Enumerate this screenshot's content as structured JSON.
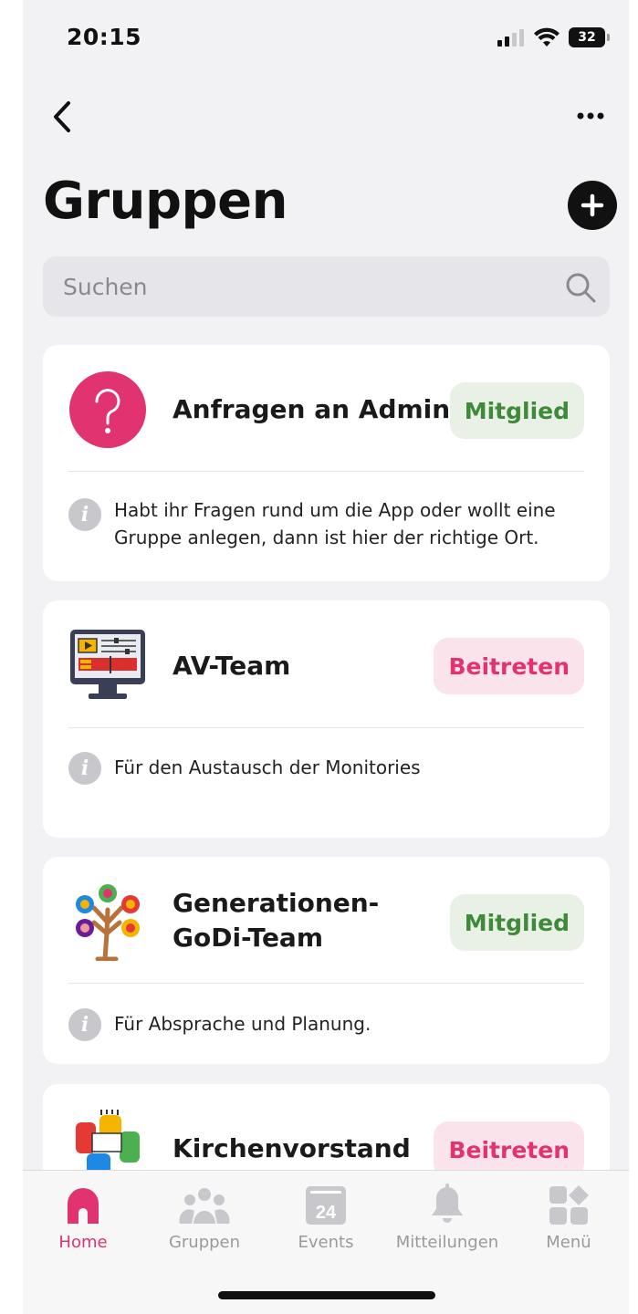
{
  "status_bar": {
    "time": "20:15",
    "battery": "32"
  },
  "header": {
    "title": "Gruppen"
  },
  "search": {
    "placeholder": "Suchen"
  },
  "groups": [
    {
      "name": "Anfragen an Admins",
      "action": "Mitglied",
      "description": "Habt ihr Fragen rund um die App oder wollt eine Gruppe anlegen, dann ist hier der richtige Ort."
    },
    {
      "name": "AV-Team",
      "action": "Beitreten",
      "description": "Für den Austausch der Monitories"
    },
    {
      "name": "Generationen-GoDi-Team",
      "action": "Mitglied",
      "description": "Für Absprache und Planung."
    },
    {
      "name": "Kirchenvorstand",
      "action": "Beitreten"
    }
  ],
  "tabs": [
    {
      "label": "Home",
      "icon": "home-icon",
      "active": true
    },
    {
      "label": "Gruppen",
      "icon": "people-icon"
    },
    {
      "label": "Events",
      "icon": "calendar-icon",
      "badge": "24"
    },
    {
      "label": "Mitteilungen",
      "icon": "bell-icon"
    },
    {
      "label": "Menü",
      "icon": "grid-icon"
    }
  ],
  "colors": {
    "accent": "#e0336f",
    "member_green": "#3f8a3a",
    "member_bg": "#e9f0e6",
    "join_bg": "#fbe3ec"
  }
}
